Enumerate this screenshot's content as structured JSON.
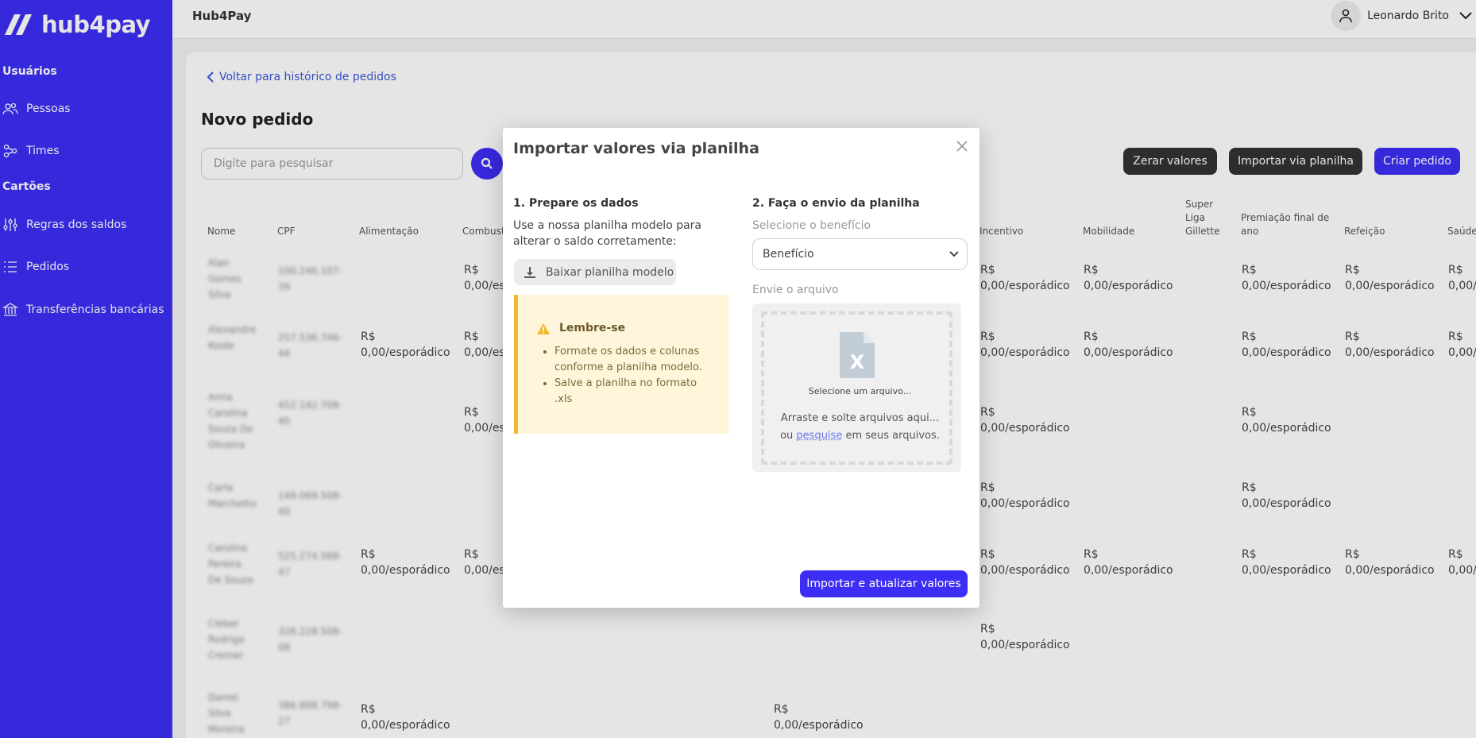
{
  "brand": {
    "name": "hub4pay"
  },
  "sidebar": {
    "section_users": "Usuários",
    "section_cards": "Cartões",
    "items": [
      {
        "label": "Pessoas",
        "icon": "users-icon"
      },
      {
        "label": "Times",
        "icon": "teams-icon"
      },
      {
        "label": "Regras dos saldos",
        "icon": "sliders-icon"
      },
      {
        "label": "Pedidos",
        "icon": "list-icon"
      },
      {
        "label": "Transferências bancárias",
        "icon": "bank-icon"
      }
    ]
  },
  "topbar": {
    "title": "Hub4Pay",
    "user_name": "Leonardo Brito"
  },
  "page": {
    "back_link": "Voltar para histórico de pedidos",
    "title": "Novo pedido",
    "search_placeholder": "Digite para pesquisar",
    "buttons": {
      "reset": "Zerar valores",
      "import": "Importar via planilha",
      "create": "Criar pedido"
    }
  },
  "table": {
    "headers": [
      "Nome",
      "CPF",
      "Alimentação",
      "Combust",
      "Incentivo",
      "Mobilidade",
      "Super Liga Gillette",
      "Premiação final de ano",
      "Refeição",
      "Saúde"
    ],
    "currency": "R$",
    "value": "0,00/esporádico",
    "value_truncated": "0,00/es",
    "value_truncated_health": "0,00/",
    "rows": [
      {
        "name": "Alan Gomes Silva",
        "cpf": "100.246.107-39"
      },
      {
        "name": "Alexandre Koide",
        "cpf": "257.536.746-44"
      },
      {
        "name": "Anna Carolina Souza De Oliveira",
        "cpf": "452.142.708-40"
      },
      {
        "name": "Carla Marchetto",
        "cpf": "149.069.508-40"
      },
      {
        "name": "Caroline Pereira De Souza",
        "cpf": "525.274.568-47"
      },
      {
        "name": "Cleber Rodrigo Cremer",
        "cpf": "326.228.508-08"
      },
      {
        "name": "Daniel Silva Moreira",
        "cpf": "386.808.798-27"
      }
    ]
  },
  "modal": {
    "title": "Importar valores via planilha",
    "step1": {
      "title": "1. Prepare os dados",
      "text": "Use a nossa planilha modelo para alterar o saldo corretamente:",
      "download_label": "Baixar planilha modelo",
      "alert_title": "Lembre-se",
      "alert_items": [
        "Formate os dados e colunas conforme a planilha modelo.",
        "Salve a planilha no formato .xls"
      ]
    },
    "step2": {
      "title": "2. Faça o envio da planilha",
      "select_label": "Selecione o benefício",
      "select_value": "Benefício",
      "file_label": "Envie o arquivo",
      "dropzone_small": "Selecione um arquivo...",
      "dropzone_line1": "Arraste e solte arquivos aqui...",
      "dropzone_prefix": "ou",
      "dropzone_link": "pesquise",
      "dropzone_suffix": "em seus arquivos."
    },
    "submit_label": "Importar e atualizar valores"
  },
  "colors": {
    "primary": "#3d2ef5",
    "dark_button": "#333333",
    "alert_bg": "#fff5da",
    "alert_border": "#f0b92b"
  }
}
